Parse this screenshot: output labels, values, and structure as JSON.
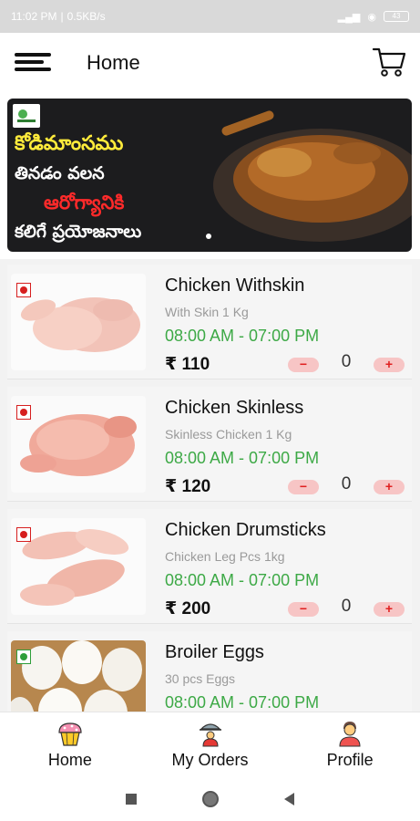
{
  "status_bar": {
    "time": "11:02 PM",
    "network_speed": "0.5KB/s",
    "battery": "43"
  },
  "app_bar": {
    "title": "Home",
    "menu_icon": "hamburger-menu-icon",
    "cart_icon": "shopping-cart-icon"
  },
  "banner": {
    "lines": [
      "కోడిమాంసము",
      "తినడం వలన",
      "ఆరోగ్యానికి",
      "కలిగే ప్రయోజనాలు"
    ]
  },
  "products": [
    {
      "name": "Chicken Withskin",
      "description": "With Skin 1 Kg",
      "timing": "08:00 AM - 07:00 PM",
      "price": "₹ 110",
      "quantity": "0",
      "type": "non-veg"
    },
    {
      "name": "Chicken Skinless",
      "description": "Skinless Chicken 1 Kg",
      "timing": "08:00 AM - 07:00 PM",
      "price": "₹ 120",
      "quantity": "0",
      "type": "non-veg"
    },
    {
      "name": "Chicken Drumsticks",
      "description": "Chicken Leg Pcs 1kg",
      "timing": "08:00 AM - 07:00 PM",
      "price": "₹ 200",
      "quantity": "0",
      "type": "non-veg"
    },
    {
      "name": "Broiler Eggs",
      "description": "30 pcs Eggs",
      "timing": "08:00 AM - 07:00 PM",
      "type": "veg"
    }
  ],
  "stepper": {
    "minus": "−",
    "plus": "+"
  },
  "bottom_nav": [
    {
      "label": "Home",
      "icon": "cupcake-icon"
    },
    {
      "label": "My Orders",
      "icon": "waiter-tray-icon"
    },
    {
      "label": "Profile",
      "icon": "user-avatar-icon"
    }
  ],
  "colors": {
    "timing_green": "#3da946",
    "stepper_bg": "#f7c5c5",
    "stepper_text": "#e02020",
    "non_veg_mark": "#d61f1f",
    "veg_mark": "#2e9e3a"
  }
}
